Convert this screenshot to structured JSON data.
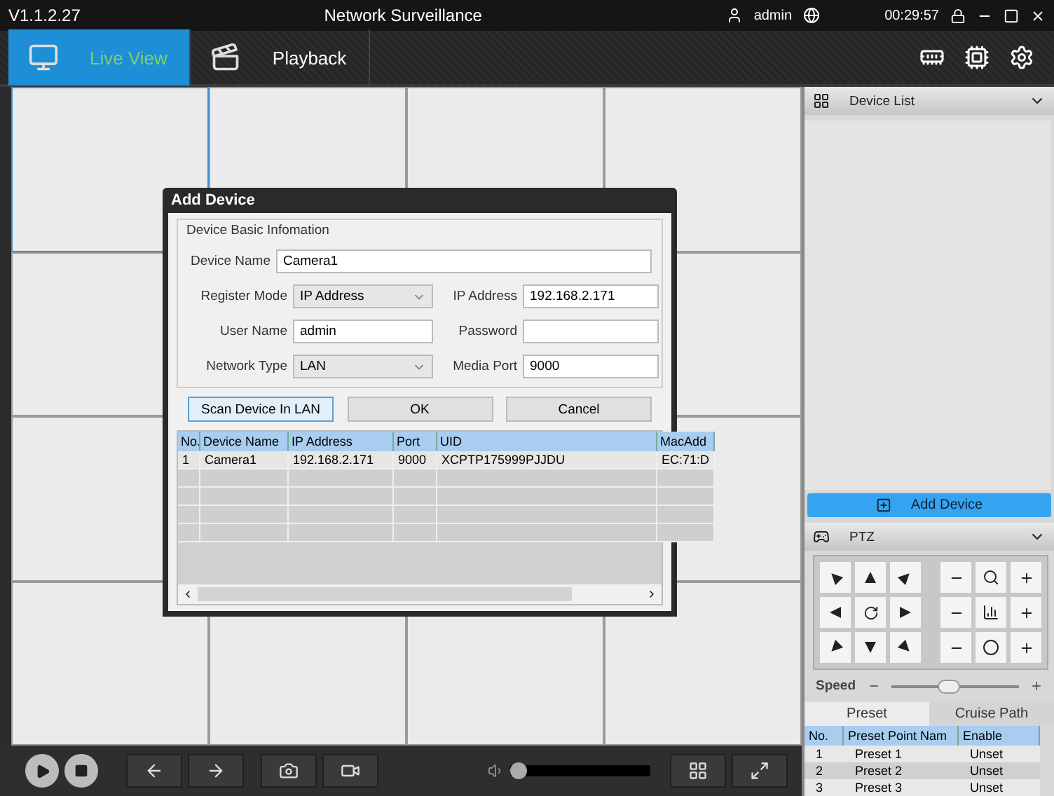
{
  "window": {
    "version": "V1.1.2.27",
    "title": "Network Surveillance",
    "user": "admin",
    "clock": "00:29:57"
  },
  "nav_tabs": [
    {
      "label": "Live View",
      "selected": true
    },
    {
      "label": "Playback",
      "selected": false
    }
  ],
  "video_grid": {
    "cells": [
      {
        "selected": true
      },
      {
        "selected": false
      },
      {
        "selected": false
      },
      {
        "selected": false
      },
      {
        "selected": false
      },
      {
        "selected": false
      },
      {
        "selected": false
      },
      {
        "selected": false
      },
      {
        "selected": false
      },
      {
        "selected": false
      },
      {
        "selected": false
      },
      {
        "selected": false
      }
    ]
  },
  "dialog": {
    "title": "Add Device",
    "group": "Device Basic Infomation",
    "device_name": {
      "label": "Device Name",
      "value": "Camera1"
    },
    "register_mode": {
      "label": "Register Mode",
      "value": "IP Address"
    },
    "ip_address": {
      "label": "IP Address",
      "value": "192.168.2.171"
    },
    "user_name": {
      "label": "User Name",
      "value": "admin"
    },
    "password": {
      "label": "Password"
    },
    "network_type": {
      "label": "Network Type",
      "value": "LAN"
    },
    "media_port": {
      "label": "Media Port",
      "value": "9000"
    },
    "buttons": [
      {
        "label": "Scan Device In LAN",
        "selected": true
      },
      {
        "label": "OK",
        "selected": false
      },
      {
        "label": "Cancel",
        "selected": false
      }
    ],
    "table": {
      "columns": [
        "No.",
        "Device Name",
        "IP Address",
        "Port",
        "UID",
        "MacAdd"
      ],
      "rows": [
        [
          "1",
          "Camera1",
          "192.168.2.171",
          "9000",
          "XCPTP175999PJJDU",
          "EC:71:D"
        ]
      ]
    }
  },
  "sidebar": {
    "device_list": {
      "title": "Device List"
    },
    "add_device": "Add Device",
    "ptz": {
      "title": "PTZ"
    },
    "speed": {
      "label": "Speed",
      "level": 0.45
    },
    "tabs": [
      {
        "label": "Preset",
        "selected": true
      },
      {
        "label": "Cruise Path",
        "selected": false
      }
    ],
    "preset_table": {
      "columns": [
        "No.",
        "Preset Point Nam",
        "Enable"
      ],
      "rows": [
        [
          "1",
          "Preset 1",
          "Unset"
        ],
        [
          "2",
          "Preset 2",
          "Unset"
        ],
        [
          "3",
          "Preset 3",
          "Unset"
        ]
      ]
    }
  },
  "toolbar": {
    "volume": {
      "level": 0.0
    }
  }
}
